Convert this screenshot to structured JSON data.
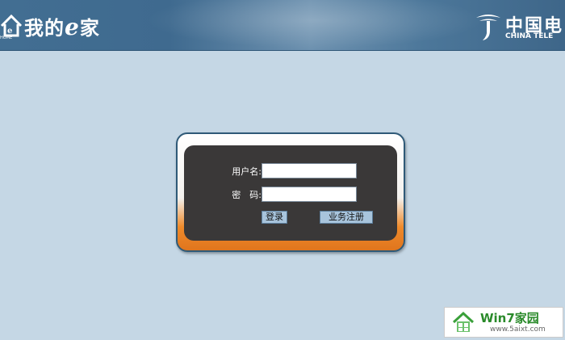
{
  "header": {
    "logo_text_prefix": "我的",
    "logo_text_e": "e",
    "logo_text_suffix": "家",
    "house_tag": "HOME",
    "telecom_cn": "中国电",
    "telecom_en": "CHINA TELE"
  },
  "login": {
    "username_label": "用户名:",
    "username_value": "",
    "password_label": "密　码:",
    "password_value": "",
    "login_button": "登录",
    "register_button": "业务注册"
  },
  "watermark": {
    "title": "Win7家园",
    "url": "www.5aixt.com"
  },
  "colors": {
    "background": "#c5d7e5",
    "header": "#426e92",
    "panel": "#3a3838",
    "accent_orange": "#ef8a2a",
    "button": "#a8c4dc"
  }
}
